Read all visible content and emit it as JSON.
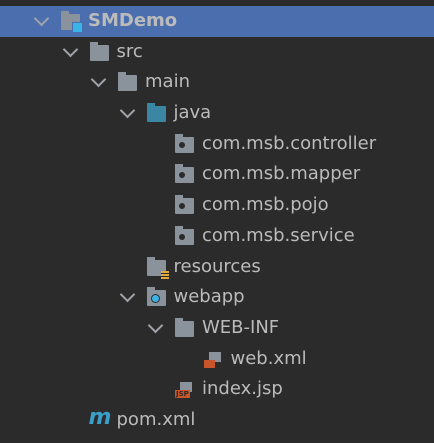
{
  "colors": {
    "background": "#2b2b2b",
    "selection": "#4b6eaf",
    "text": "#bbbbbb"
  },
  "tree": [
    {
      "label": "SMDemo",
      "icon": "module-folder-icon",
      "level": 0,
      "expanded": true,
      "selected": true
    },
    {
      "label": "src",
      "icon": "folder-icon",
      "level": 1,
      "expanded": true
    },
    {
      "label": "main",
      "icon": "folder-icon",
      "level": 2,
      "expanded": true
    },
    {
      "label": "java",
      "icon": "source-folder-icon",
      "level": 3,
      "expanded": true
    },
    {
      "label": "com.msb.controller",
      "icon": "package-icon",
      "level": 4
    },
    {
      "label": "com.msb.mapper",
      "icon": "package-icon",
      "level": 4
    },
    {
      "label": "com.msb.pojo",
      "icon": "package-icon",
      "level": 4
    },
    {
      "label": "com.msb.service",
      "icon": "package-icon",
      "level": 4
    },
    {
      "label": "resources",
      "icon": "resources-folder-icon",
      "level": 3
    },
    {
      "label": "webapp",
      "icon": "web-folder-icon",
      "level": 3,
      "expanded": true
    },
    {
      "label": "WEB-INF",
      "icon": "folder-icon",
      "level": 4,
      "expanded": true
    },
    {
      "label": "web.xml",
      "icon": "xml-file-icon",
      "level": 5
    },
    {
      "label": "index.jsp",
      "icon": "jsp-file-icon",
      "level": 4,
      "badge": "JSP"
    },
    {
      "label": "pom.xml",
      "icon": "maven-icon",
      "level": 1,
      "glyph": "m"
    }
  ]
}
